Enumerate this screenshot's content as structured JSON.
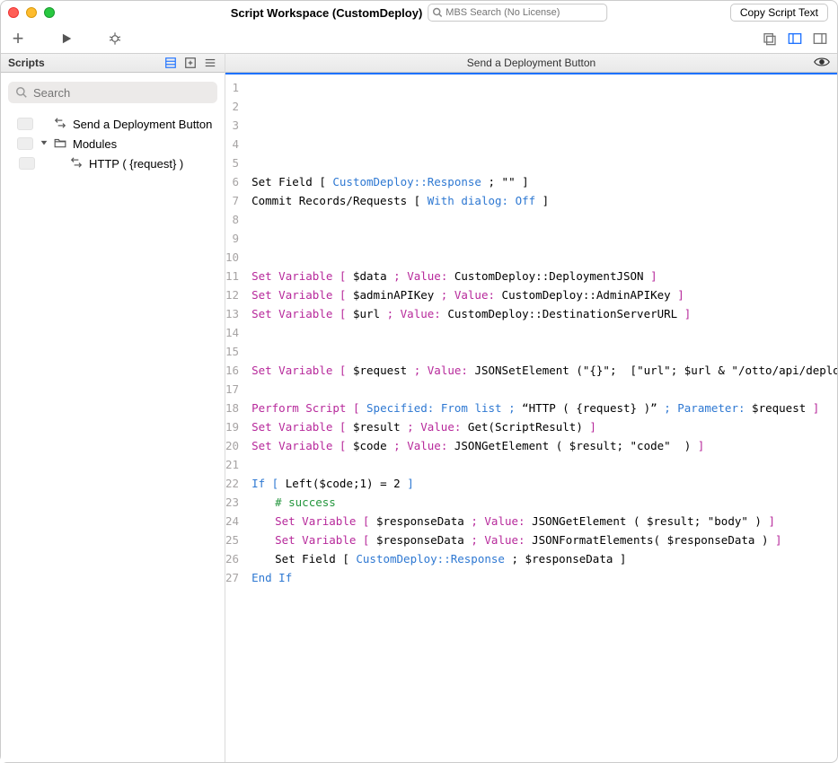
{
  "window": {
    "title": "Script Workspace (CustomDeploy)",
    "mbs_placeholder": "MBS Search (No License)",
    "copy_button": "Copy Script Text"
  },
  "sidebar": {
    "title": "Scripts",
    "search_placeholder": "Search",
    "items": [
      {
        "label": "Send a Deployment Button",
        "level": 1,
        "kind": "script"
      },
      {
        "label": "Modules",
        "level": 1,
        "kind": "folder",
        "expanded": true
      },
      {
        "label": "HTTP ( {request} )",
        "level": 2,
        "kind": "script"
      }
    ]
  },
  "editor": {
    "title": "Send a Deployment Button"
  },
  "script": {
    "lines": [
      {
        "n": 1,
        "raw": ""
      },
      {
        "n": 2,
        "raw": ""
      },
      {
        "n": 3,
        "raw": ""
      },
      {
        "n": 4,
        "raw": ""
      },
      {
        "n": 5,
        "raw": ""
      },
      {
        "n": 6,
        "raw": "Set Field [ CustomDeploy::Response ; \"\" ]"
      },
      {
        "n": 7,
        "raw": "Commit Records/Requests [ With dialog: Off ]"
      },
      {
        "n": 8,
        "raw": ""
      },
      {
        "n": 9,
        "raw": ""
      },
      {
        "n": 10,
        "raw": ""
      },
      {
        "n": 11,
        "raw": "Set Variable [ $data ; Value: CustomDeploy::DeploymentJSON ]"
      },
      {
        "n": 12,
        "raw": "Set Variable [ $adminAPIKey ; Value: CustomDeploy::AdminAPIKey ]"
      },
      {
        "n": 13,
        "raw": "Set Variable [ $url ; Value: CustomDeploy::DestinationServerURL ]"
      },
      {
        "n": 14,
        "raw": ""
      },
      {
        "n": 15,
        "raw": ""
      },
      {
        "n": 16,
        "raw": "Set Variable [ $request ; Value: JSONSetElement (\"{}\";  [\"url\"; $url & \"/otto/api/deployment…  ]"
      },
      {
        "n": 17,
        "raw": ""
      },
      {
        "n": 18,
        "raw": "Perform Script [ Specified: From list ; “HTTP ( {request} )” ; Parameter: $request ]"
      },
      {
        "n": 19,
        "raw": "Set Variable [ $result ; Value: Get(ScriptResult) ]"
      },
      {
        "n": 20,
        "raw": "Set Variable [ $code ; Value: JSONGetElement ( $result; \"code\"  ) ]"
      },
      {
        "n": 21,
        "raw": ""
      },
      {
        "n": 22,
        "raw": "If [ Left($code;1) = 2 ]"
      },
      {
        "n": 23,
        "raw": "    # success"
      },
      {
        "n": 24,
        "raw": "    Set Variable [ $responseData ; Value: JSONGetElement ( $result; \"body\" ) ]"
      },
      {
        "n": 25,
        "raw": "    Set Variable [ $responseData ; Value: JSONFormatElements( $responseData ) ]"
      },
      {
        "n": 26,
        "raw": "    Set Field [ CustomDeploy::Response ; $responseData ]"
      },
      {
        "n": 27,
        "raw": "End If"
      }
    ]
  },
  "colors": {
    "keyword": "#2e78d2",
    "step": "#b7299b",
    "comment": "#24963d",
    "accent": "#1e72ff"
  }
}
